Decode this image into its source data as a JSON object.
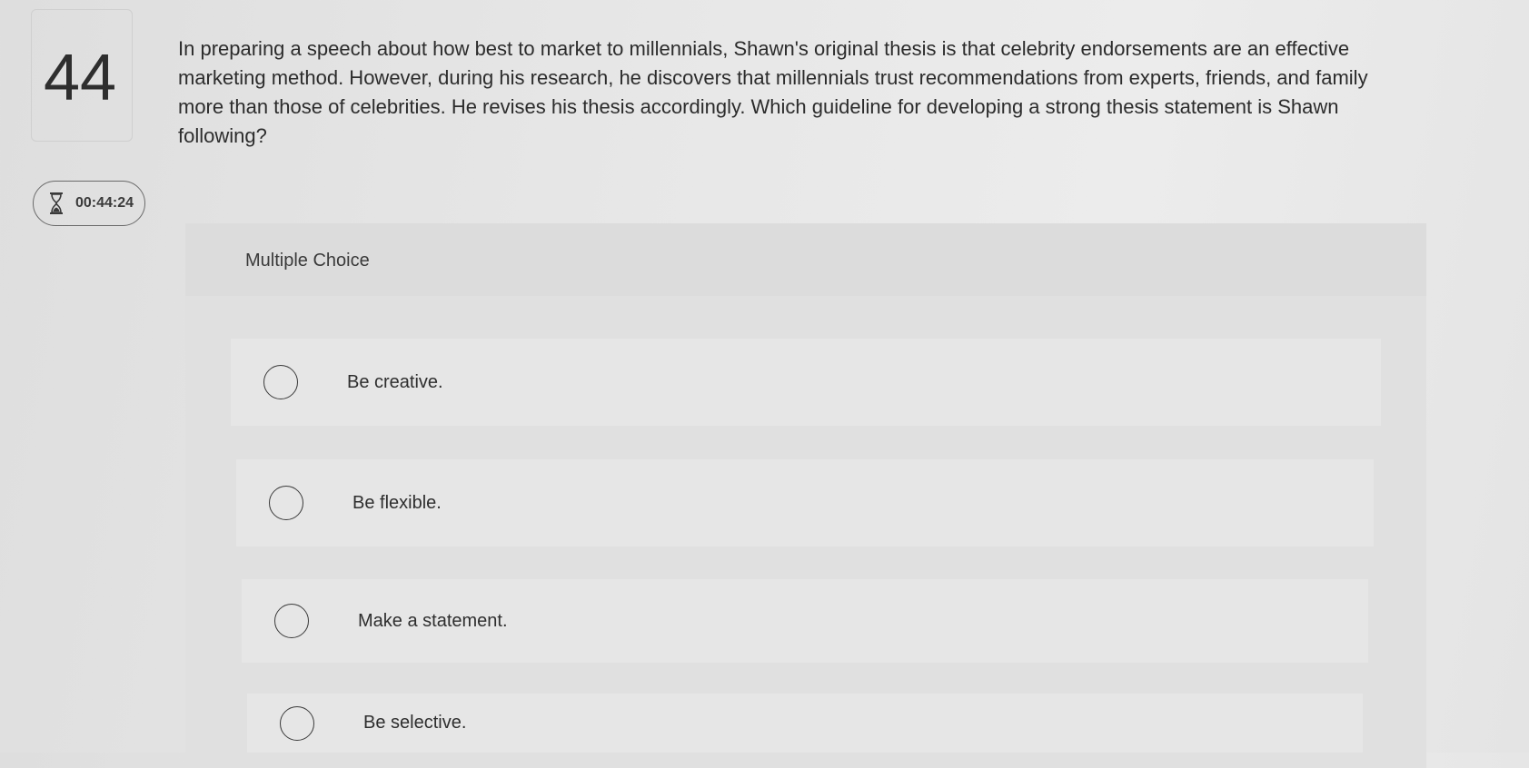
{
  "question": {
    "number": "44",
    "text": "In preparing a speech about how best to market to millennials, Shawn's original thesis is that celebrity endorsements are an effective marketing method. However, during his research, he discovers that millennials trust recommendations from experts, friends, and family more than those of celebrities. He revises his thesis accordingly. Which guideline for developing a strong thesis statement is Shawn following?"
  },
  "timer": {
    "icon": "hourglass-icon",
    "value": "00:44:24"
  },
  "multiple_choice": {
    "label": "Multiple Choice",
    "options": [
      {
        "label": "Be creative."
      },
      {
        "label": "Be flexible."
      },
      {
        "label": "Make a statement."
      },
      {
        "label": "Be selective."
      }
    ]
  },
  "colors": {
    "background": "#e6e6e6",
    "panel": "#e0e0e0",
    "text": "#2c2c2c"
  }
}
